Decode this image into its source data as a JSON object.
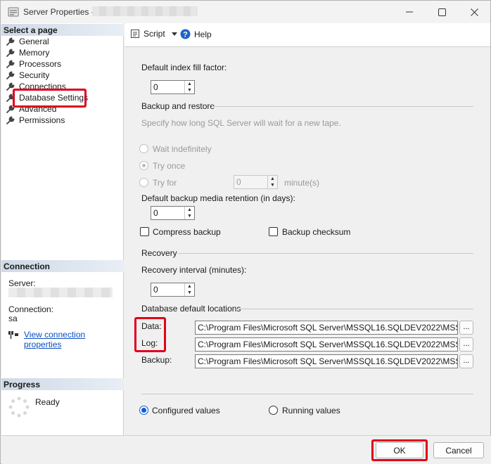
{
  "window": {
    "title": "Server Properties -",
    "minimize_icon": "minimize-icon",
    "maximize_icon": "maximize-icon",
    "close_icon": "close-icon"
  },
  "left": {
    "select_page_header": "Select a page",
    "pages": [
      {
        "label": "General"
      },
      {
        "label": "Memory"
      },
      {
        "label": "Processors"
      },
      {
        "label": "Security"
      },
      {
        "label": "Connections"
      },
      {
        "label": "Database Settings"
      },
      {
        "label": "Advanced"
      },
      {
        "label": "Permissions"
      }
    ],
    "connection_header": "Connection",
    "server_label": "Server:",
    "connection_label": "Connection:",
    "connection_value": "sa",
    "view_conn_link": "View connection properties",
    "progress_header": "Progress",
    "progress_status": "Ready"
  },
  "toolbar": {
    "script_label": "Script",
    "help_label": "Help"
  },
  "settings": {
    "fill_factor_label": "Default index fill factor:",
    "fill_factor_value": "0",
    "backup_group": "Backup and restore",
    "backup_hint": "Specify how long SQL Server will wait for a new tape.",
    "wait_indefinitely": "Wait indefinitely",
    "try_once": "Try once",
    "try_for": "Try for",
    "try_for_value": "0",
    "minutes_label": "minute(s)",
    "retention_label": "Default backup media retention (in days):",
    "retention_value": "0",
    "compress_backup": "Compress backup",
    "backup_checksum": "Backup checksum",
    "recovery_group": "Recovery",
    "recovery_interval_label": "Recovery interval (minutes):",
    "recovery_interval_value": "0",
    "locations_group": "Database default locations",
    "data_label": "Data:",
    "data_path": "C:\\Program Files\\Microsoft SQL Server\\MSSQL16.SQLDEV2022\\MSSQL\\DATA",
    "log_label": "Log:",
    "log_path": "C:\\Program Files\\Microsoft SQL Server\\MSSQL16.SQLDEV2022\\MSSQL\\DATA",
    "backup_label": "Backup:",
    "backup_path": "C:\\Program Files\\Microsoft SQL Server\\MSSQL16.SQLDEV2022\\MSSQL\\Backup",
    "browse_label": "...",
    "configured_values": "Configured values",
    "running_values": "Running values"
  },
  "footer": {
    "ok_label": "OK",
    "cancel_label": "Cancel"
  },
  "colors": {
    "highlight": "#e0001b",
    "link": "#0b4fbf",
    "radio_accent": "#0b5cd6"
  }
}
